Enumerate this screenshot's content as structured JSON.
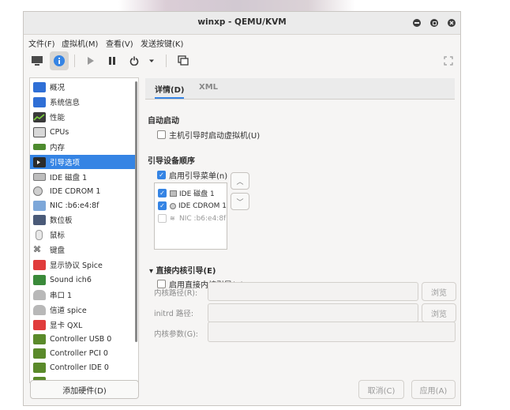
{
  "window": {
    "title": "winxp - QEMU/KVM"
  },
  "menubar": [
    "文件(F)",
    "虚拟机(M)",
    "查看(V)",
    "发送按键(K)"
  ],
  "sidebar": {
    "items": [
      {
        "label": "概况",
        "icon": "monitor-icon"
      },
      {
        "label": "系统信息",
        "icon": "monitor-icon"
      },
      {
        "label": "性能",
        "icon": "performance-icon"
      },
      {
        "label": "CPUs",
        "icon": "cpu-icon"
      },
      {
        "label": "内存",
        "icon": "memory-icon"
      },
      {
        "label": "引导选项",
        "icon": "boot-icon",
        "selected": true
      },
      {
        "label": "IDE 磁盘 1",
        "icon": "disk-icon"
      },
      {
        "label": "IDE CDROM 1",
        "icon": "cdrom-icon"
      },
      {
        "label": "NIC :b6:e4:8f",
        "icon": "network-icon"
      },
      {
        "label": "数位板",
        "icon": "tablet-icon"
      },
      {
        "label": "鼠标",
        "icon": "mouse-icon"
      },
      {
        "label": "键盘",
        "icon": "keyboard-icon"
      },
      {
        "label": "显示协议 Spice",
        "icon": "display-icon"
      },
      {
        "label": "Sound ich6",
        "icon": "sound-icon"
      },
      {
        "label": "串口 1",
        "icon": "serial-icon"
      },
      {
        "label": "信道 spice",
        "icon": "channel-icon"
      },
      {
        "label": "显卡 QXL",
        "icon": "video-icon"
      },
      {
        "label": "Controller USB 0",
        "icon": "controller-icon"
      },
      {
        "label": "Controller PCI 0",
        "icon": "controller-icon"
      },
      {
        "label": "Controller IDE 0",
        "icon": "controller-icon"
      }
    ],
    "add_hardware": "添加硬件(D)"
  },
  "tabs": {
    "details": "详情(D)",
    "xml": "XML"
  },
  "autostart": {
    "heading": "自动启动",
    "checkbox": "主机引导时启动虚拟机(U)",
    "checked": false
  },
  "boot_order": {
    "heading": "引导设备顺序",
    "menu_checkbox": "启用引导菜单(n)",
    "menu_checked": true,
    "devices": [
      {
        "label": "IDE 磁盘 1",
        "checked": true,
        "icon": "disk-icon"
      },
      {
        "label": "IDE CDROM 1",
        "checked": true,
        "icon": "cdrom-icon"
      },
      {
        "label": "NIC :b6:e4:8f",
        "checked": false,
        "icon": "network-icon"
      }
    ]
  },
  "direct_kernel": {
    "heading": "直接内核引导(E)",
    "checkbox": "启用直接内核引导(B)",
    "checked": false,
    "kernel_label": "内核路径(R):",
    "initrd_label": "initrd 路径:",
    "args_label": "内核参数(G):",
    "browse": "浏览"
  },
  "buttons": {
    "cancel": "取消(C)",
    "apply": "应用(A)"
  },
  "colors": {
    "accent": "#3584e4"
  }
}
